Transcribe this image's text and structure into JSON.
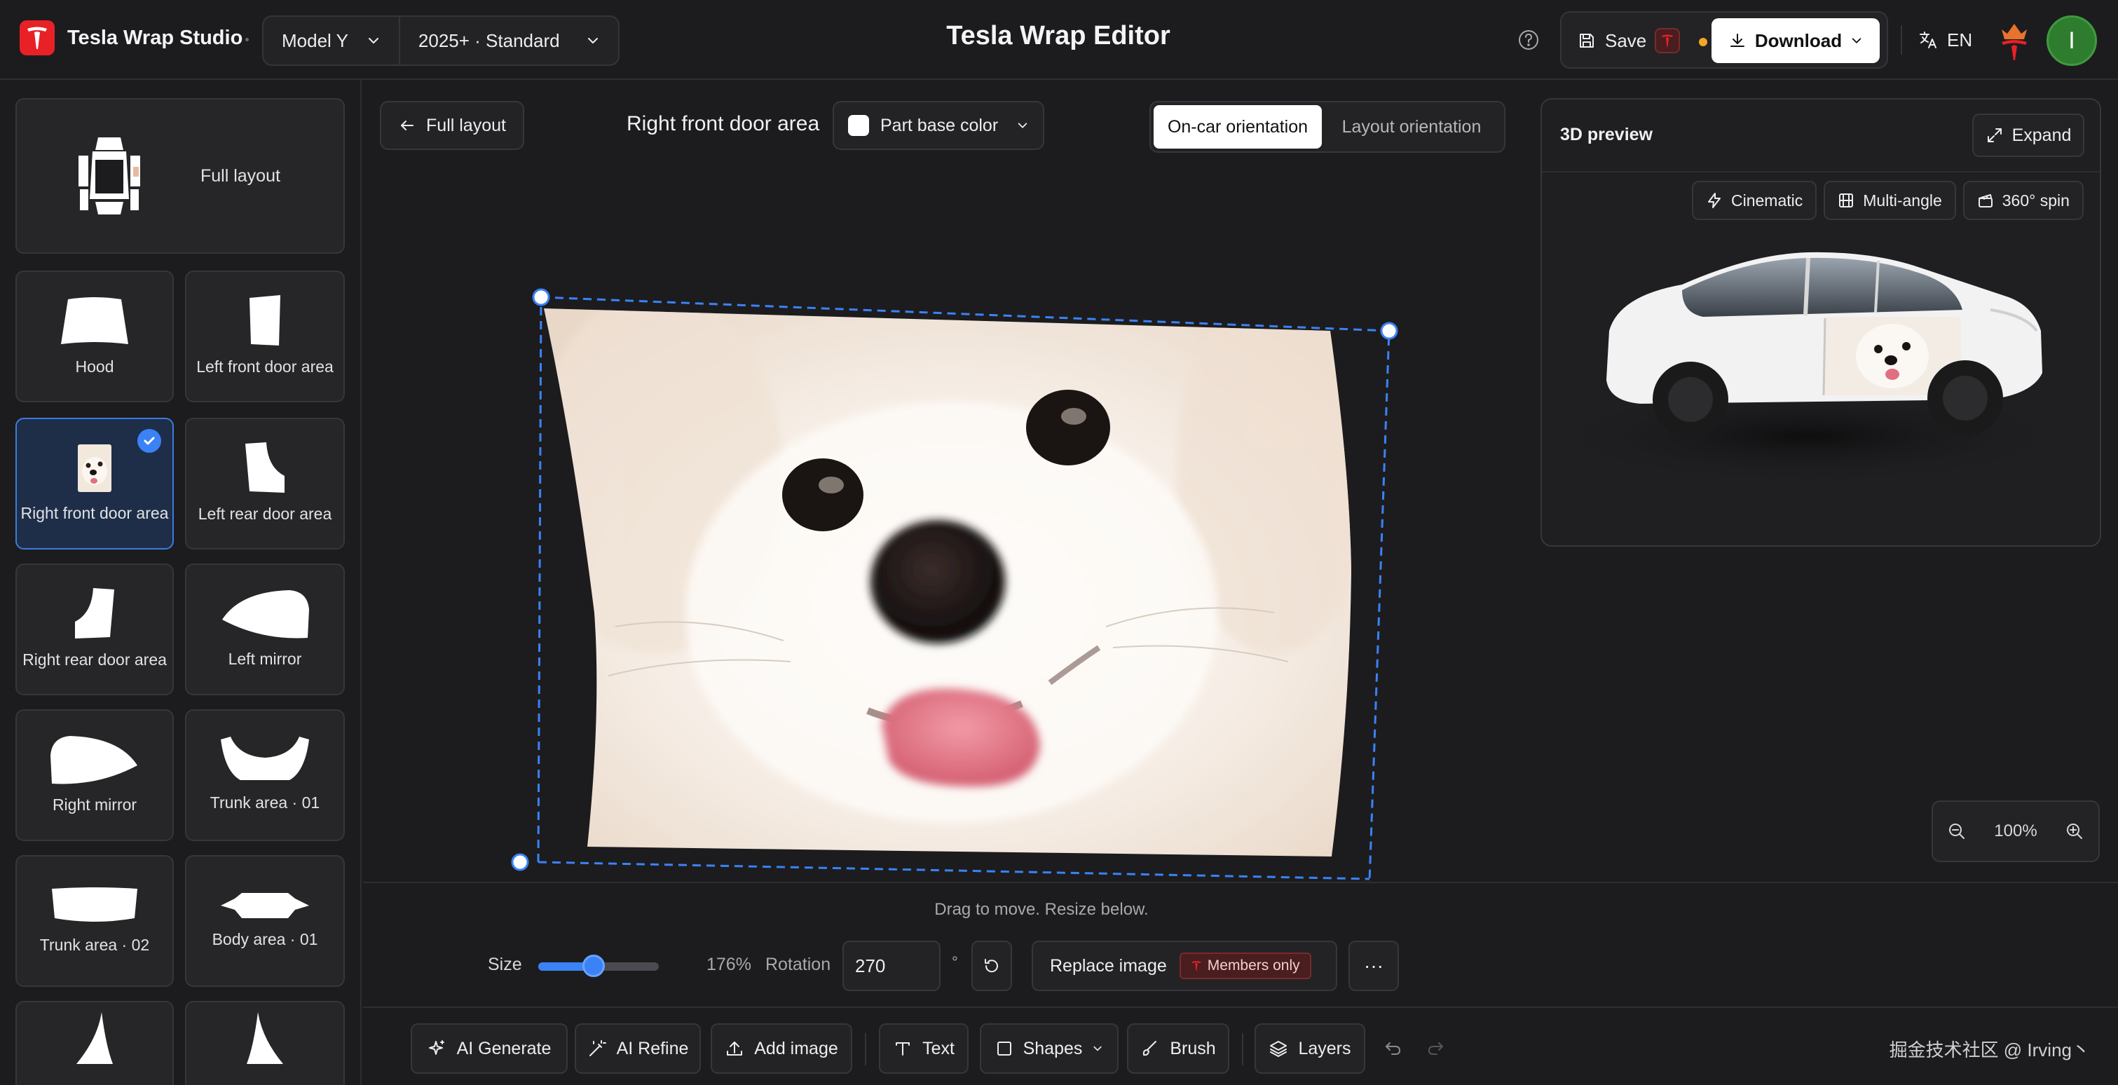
{
  "header": {
    "brand": "Tesla Wrap Studio",
    "model": "Model Y",
    "variant": "2025+ · Standard",
    "title": "Tesla Wrap Editor",
    "save_label": "Save",
    "download_label": "Download",
    "lang_label": "EN",
    "avatar_initial": "I"
  },
  "sidebar": {
    "full_layout_label": "Full layout",
    "parts": [
      {
        "label": "Hood",
        "icon": "hood-shape"
      },
      {
        "label": "Left front door area",
        "icon": "door-shape"
      },
      {
        "label": "Right front door area",
        "icon": "dog-thumbnail",
        "selected": true
      },
      {
        "label": "Left rear door area",
        "icon": "door-shape"
      },
      {
        "label": "Right rear door area",
        "icon": "door-shape"
      },
      {
        "label": "Left mirror",
        "icon": "mirror-shape"
      },
      {
        "label": "Right mirror",
        "icon": "mirror-shape"
      },
      {
        "label": "Trunk area · 01",
        "icon": "trunk-shape"
      },
      {
        "label": "Trunk area · 02",
        "icon": "trunk-shape"
      },
      {
        "label": "Body area · 01",
        "icon": "body-shape"
      }
    ]
  },
  "editor": {
    "back_label": "Full layout",
    "area_title": "Right front door area",
    "base_color_label": "Part base color",
    "orientation": {
      "active": "On-car orientation",
      "inactive": "Layout orientation"
    }
  },
  "preview": {
    "title": "3D preview",
    "expand_label": "Expand",
    "actions": [
      "Cinematic",
      "Multi-angle",
      "360° spin"
    ],
    "zoom": "100%"
  },
  "transform": {
    "hint": "Drag to move. Resize below.",
    "size_label": "Size",
    "size_value": "176%",
    "size_fraction": 0.45,
    "rotation_label": "Rotation",
    "rotation_value": "270",
    "degree_symbol": "°",
    "replace_label": "Replace image",
    "members_label": "Members only",
    "more_label": "···"
  },
  "tools": {
    "ai_generate": "AI Generate",
    "ai_refine": "AI Refine",
    "add_image": "Add image",
    "text": "Text",
    "shapes": "Shapes",
    "brush": "Brush",
    "layers": "Layers"
  },
  "watermark": "掘金技术社区 @ Irving丶",
  "colors": {
    "accent": "#3b82f6",
    "brand_red": "#e82127",
    "background": "#1c1c1e",
    "panel": "#232326"
  }
}
